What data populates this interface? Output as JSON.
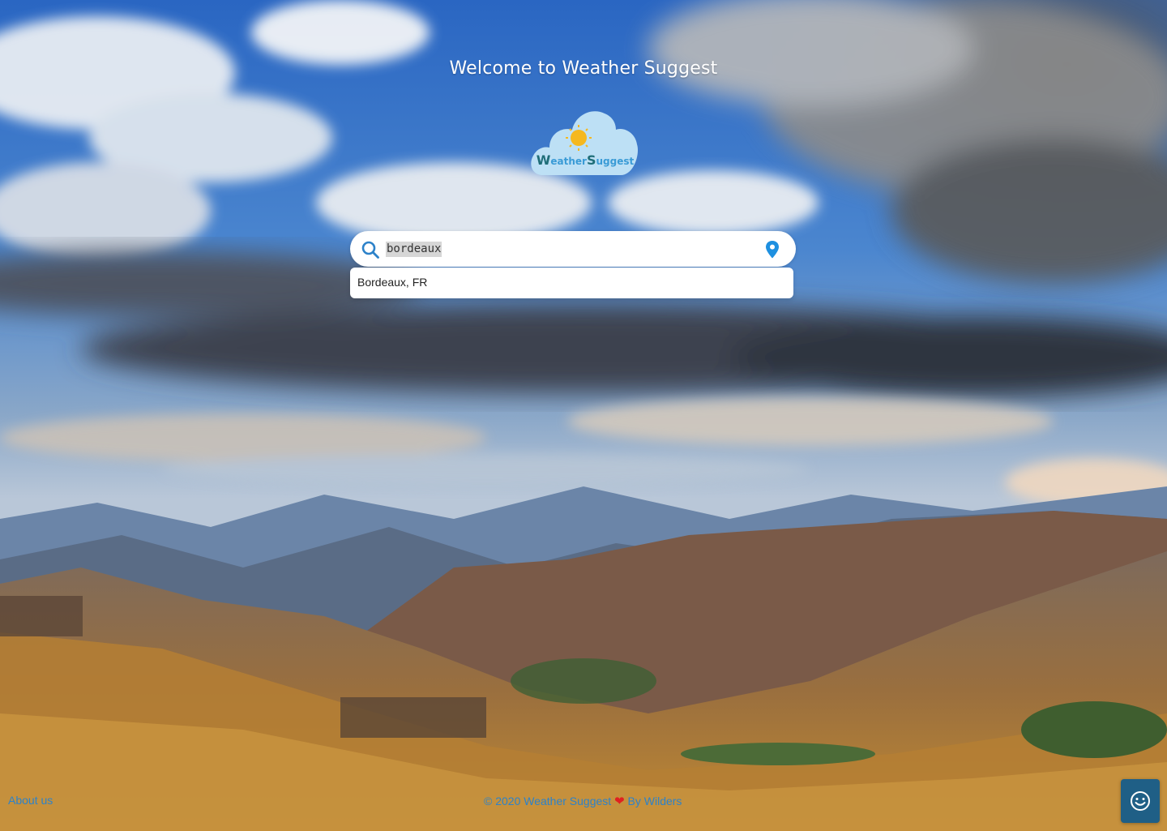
{
  "header": {
    "welcome_text": "Welcome to Weather Suggest"
  },
  "logo": {
    "w_letter": "W",
    "eather_text": "eather",
    "s_letter": "S",
    "uggest_text": "uggest"
  },
  "search": {
    "value": "bordeaux",
    "icon": "search-icon",
    "location_icon": "map-pin-icon"
  },
  "suggestions": [
    {
      "label": "Bordeaux, FR"
    }
  ],
  "footer": {
    "about_label": "About us",
    "copyright_text": "© 2020 Weather Suggest",
    "heart_symbol": "❤",
    "by_text": " By Wilders"
  },
  "chat": {
    "icon": "smiley-icon"
  },
  "colors": {
    "accent_blue": "#2d82c9",
    "pin_blue": "#1e90e0",
    "chat_bg": "#1f5f86",
    "heart_red": "#e02020"
  }
}
